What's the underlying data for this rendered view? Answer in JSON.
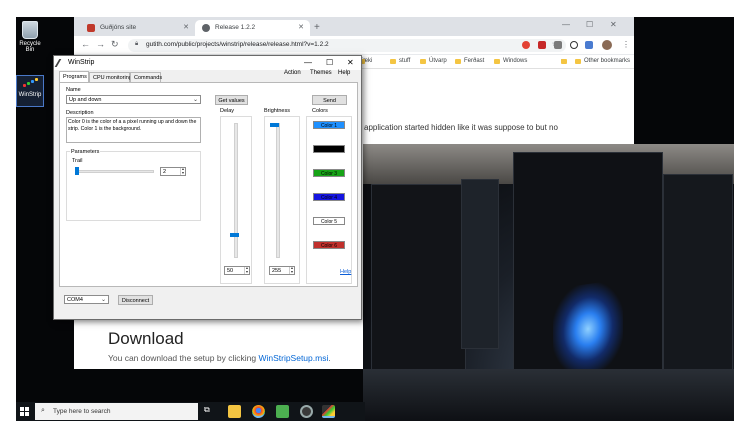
{
  "desktop": {
    "recycle_bin_label": "Recycle Bin",
    "winstrip_label": "WinStrip"
  },
  "browser": {
    "tabs": [
      {
        "label": "Guðjóns site"
      },
      {
        "label": "Release 1.2.2"
      }
    ],
    "new_tab_glyph": "+",
    "url": "gutith.com/public/projects/winstrip/release/release.html?v=1.2.2",
    "bookmarks": [
      "Tæki",
      "stuff",
      "Útvarp",
      "Ferðast",
      "Windows"
    ],
    "other_bookmarks": "Other bookmarks",
    "overflow": "»",
    "page_text_fragment": "d the application started hidden like it was suppose to but no",
    "download_heading": "Download",
    "download_text": "You can download the setup by clicking ",
    "download_link": "WinStripSetup.msi",
    "download_period": "."
  },
  "winstrip": {
    "title": "WinStrip",
    "menu": [
      "Action",
      "Themes",
      "Help"
    ],
    "tabs": [
      "Programs",
      "CPU monitoring",
      "Commands"
    ],
    "name_label": "Name",
    "program_selected": "Up and down",
    "get_values_button": "Get values",
    "send_button": "Send",
    "description_label": "Description",
    "description_text": "Color 0 is the color of a a pixel running up and down the strip. Color 1 is the background.",
    "parameters_label": "Parameters",
    "trail_label": "Trail",
    "trail_value": "2",
    "delay_label": "Delay",
    "delay_value": "50",
    "brightness_label": "Brightness",
    "brightness_value": "255",
    "colors_label": "Colors",
    "colors": [
      {
        "label": "Color 1",
        "bg": "#1e90ff",
        "fg": "#000000"
      },
      {
        "label": "Color 2",
        "bg": "#000000",
        "fg": "#000000"
      },
      {
        "label": "Color 3",
        "bg": "#16a316",
        "fg": "#000000"
      },
      {
        "label": "Color 4",
        "bg": "#1414e0",
        "fg": "#000000"
      },
      {
        "label": "Color 5",
        "bg": "#ffffff",
        "fg": "#000000"
      },
      {
        "label": "Color 6",
        "bg": "#c0302c",
        "fg": "#000000"
      }
    ],
    "help_link": "Help",
    "port_selected": "COM4",
    "disconnect_button": "Disconnect"
  },
  "taskbar": {
    "search_placeholder": "Type here to search"
  },
  "accent_color": "#0078d7"
}
